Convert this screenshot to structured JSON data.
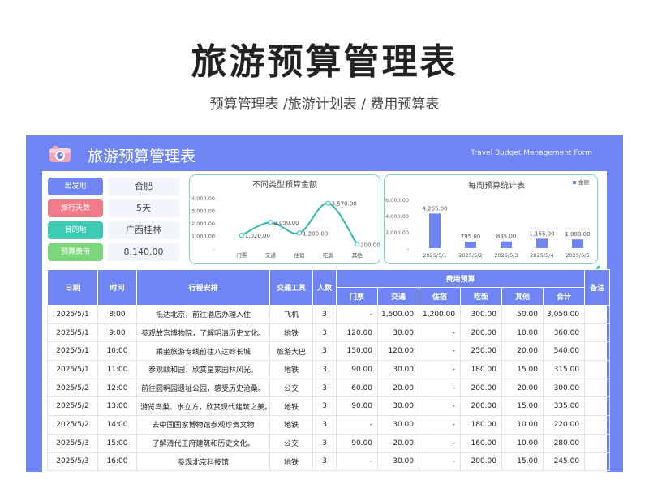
{
  "page": {
    "title": "旅游预算管理表",
    "subtitle": "预算管理表 /旅游计划表 / 费用预算表"
  },
  "sheet": {
    "title": "旅游预算管理表",
    "title_en": "Travel Budget Management Form",
    "accent_color": "#6e85f3",
    "icon": "camera-icon",
    "decoration": "palm-tree-icon"
  },
  "info": [
    {
      "label": "出发地",
      "value": "合肥",
      "color": "#6e85f3"
    },
    {
      "label": "旅行天数",
      "value": "5天",
      "color": "#f07b8a"
    },
    {
      "label": "目的地",
      "value": "广西桂林",
      "color": "#3ecbb4"
    },
    {
      "label": "预算费用",
      "value": "8,140.00",
      "color": "#7ed67c"
    }
  ],
  "chart_data": [
    {
      "type": "line",
      "title": "不同类型预算金额",
      "categories": [
        "门票",
        "交通",
        "住宿",
        "吃饭",
        "其他"
      ],
      "values": [
        1020,
        2050,
        1200,
        3570,
        300
      ],
      "data_labels": [
        "1,020.00",
        "2,050.00",
        "1,200.00",
        "3,570.00",
        "300.00"
      ],
      "yticks": [
        "4,000.00",
        "3,000.00",
        "2,000.00",
        "1,000.00",
        "-"
      ],
      "ylim": [
        0,
        4000
      ],
      "color": "#2fb8b0"
    },
    {
      "type": "bar",
      "title": "每周预算统计表",
      "legend": "金额",
      "categories": [
        "2025/5/1",
        "2025/5/2",
        "2025/5/3",
        "2025/5/4",
        "2025/5/5"
      ],
      "values": [
        4265,
        795,
        835,
        1165,
        1080
      ],
      "data_labels": [
        "4,265.00",
        "795.00",
        "835.00",
        "1,165.00",
        "1,080.00"
      ],
      "yticks": [
        "6,000.00",
        "4,000.00",
        "2,000.00",
        "-"
      ],
      "ylim": [
        0,
        6000
      ],
      "color": "#6e85f3"
    }
  ],
  "table": {
    "headers": {
      "date": "日期",
      "time": "时间",
      "itinerary": "行程安排",
      "transport": "交通工具",
      "people": "人数",
      "cost_group": "费用预算",
      "remark": "备注",
      "sub": [
        "门票",
        "交通",
        "住宿",
        "吃饭",
        "其他",
        "合计"
      ]
    },
    "rows": [
      [
        "2025/5/1",
        "8:00",
        "抵达北京，前往酒店办理入住",
        "飞机",
        "3",
        "-",
        "1,500.00",
        "1,200.00",
        "300.00",
        "50.00",
        "3,050.00",
        ""
      ],
      [
        "2025/5/1",
        "9:00",
        "参观故宫博物院，了解明清历史文化。",
        "地铁",
        "3",
        "120.00",
        "30.00",
        "-",
        "200.00",
        "10.00",
        "360.00",
        ""
      ],
      [
        "2025/5/1",
        "10:00",
        "乘坐旅游专线前往八达岭长城",
        "旅游大巴",
        "3",
        "150.00",
        "120.00",
        "-",
        "250.00",
        "20.00",
        "540.00",
        ""
      ],
      [
        "2025/5/1",
        "11:00",
        "参观颐和园，欣赏皇家园林风光。",
        "地铁",
        "3",
        "90.00",
        "30.00",
        "-",
        "180.00",
        "15.00",
        "315.00",
        ""
      ],
      [
        "2025/5/2",
        "12:00",
        "前往圆明园遗址公园，感受历史沧桑。",
        "公交",
        "3",
        "60.00",
        "20.00",
        "-",
        "200.00",
        "20.00",
        "300.00",
        ""
      ],
      [
        "2025/5/2",
        "13:00",
        "游览鸟巢、水立方，欣赏现代建筑之美。",
        "地铁",
        "3",
        "90.00",
        "30.00",
        "-",
        "200.00",
        "15.00",
        "335.00",
        ""
      ],
      [
        "2025/5/2",
        "14:00",
        "去中国国家博物馆参观珍贵文物",
        "地铁",
        "3",
        "-",
        "30.00",
        "-",
        "180.00",
        "10.00",
        "220.00",
        ""
      ],
      [
        "2025/5/3",
        "15:00",
        "了解清代王府建筑和历史文化。",
        "公交",
        "3",
        "90.00",
        "20.00",
        "-",
        "160.00",
        "10.00",
        "280.00",
        ""
      ],
      [
        "2025/5/3",
        "16:00",
        "参观北京科技馆",
        "地铁",
        "3",
        "-",
        "30.00",
        "-",
        "200.00",
        "15.00",
        "245.00",
        ""
      ]
    ]
  }
}
